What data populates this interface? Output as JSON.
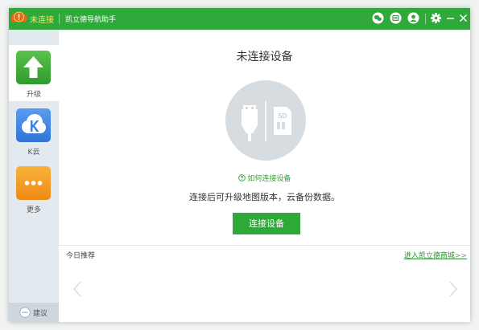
{
  "titlebar": {
    "status_text": "未连接",
    "app_title": "凯立德导航助手",
    "icons": [
      "wechat-icon",
      "message-icon",
      "user-icon",
      "settings-icon",
      "minimize-icon",
      "close-icon"
    ]
  },
  "sidebar": {
    "items": [
      {
        "label": "升级",
        "icon": "upgrade-arrow-icon",
        "color": "#3fae3a"
      },
      {
        "label": "K云",
        "icon": "k-cloud-icon",
        "color": "#3c84e6"
      },
      {
        "label": "更多",
        "icon": "more-dots-icon",
        "color": "#f39a1e"
      }
    ],
    "feedback_label": "建议"
  },
  "main": {
    "title": "未连接设备",
    "help_link": "如何连接设备",
    "description": "连接后可升级地图版本，云备份数据。",
    "connect_button": "连接设备",
    "sd_label": "SD",
    "recommend_label": "今日推荐",
    "store_link": "进入凯立德商城",
    "store_arrows": ">>"
  },
  "colors": {
    "accent": "#30a83b",
    "status_text": "#ffe25a",
    "link": "#2e8b34"
  }
}
